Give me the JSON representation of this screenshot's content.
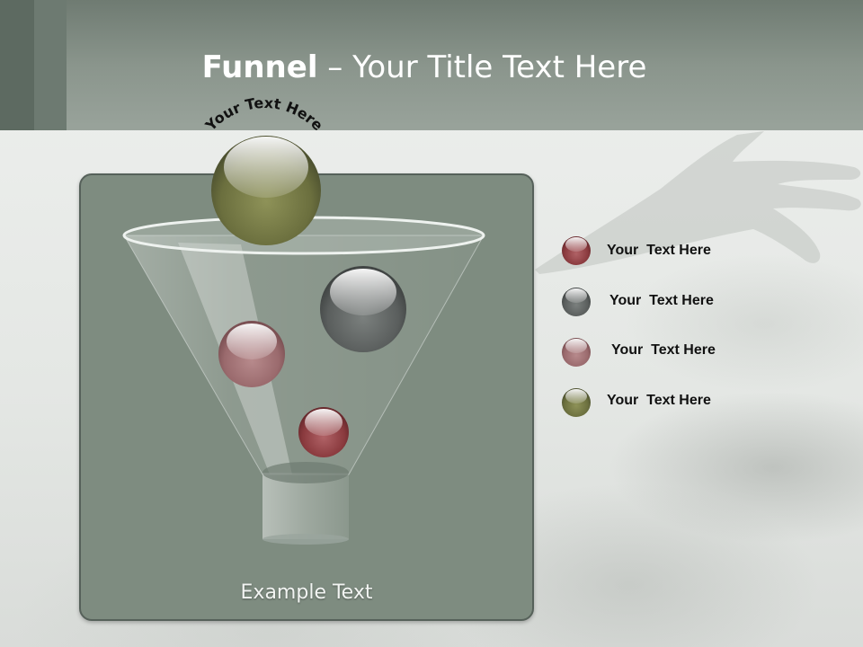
{
  "slide": {
    "title_bold": "Funnel",
    "title_rest": " – Your Title Text Here",
    "arc_label": "Your Text Here",
    "example_text": "Example Text",
    "legend": [
      {
        "label": "Your  Text Here",
        "color": "#8a3a3e"
      },
      {
        "label": "Your  Text Here",
        "color": "#555a5a"
      },
      {
        "label": "Your  Text Here",
        "color": "#9a6f72"
      },
      {
        "label": "Your  Text Here",
        "color": "#626a3f"
      }
    ]
  },
  "colors": {
    "header": "#8a958c",
    "panel": "#7e8c80",
    "panel_border": "#56615a",
    "ball_olive": "#6b6f3e",
    "ball_gray": "#5a5e5d",
    "ball_rose": "#9a5f62",
    "ball_red": "#8a3a3e"
  }
}
